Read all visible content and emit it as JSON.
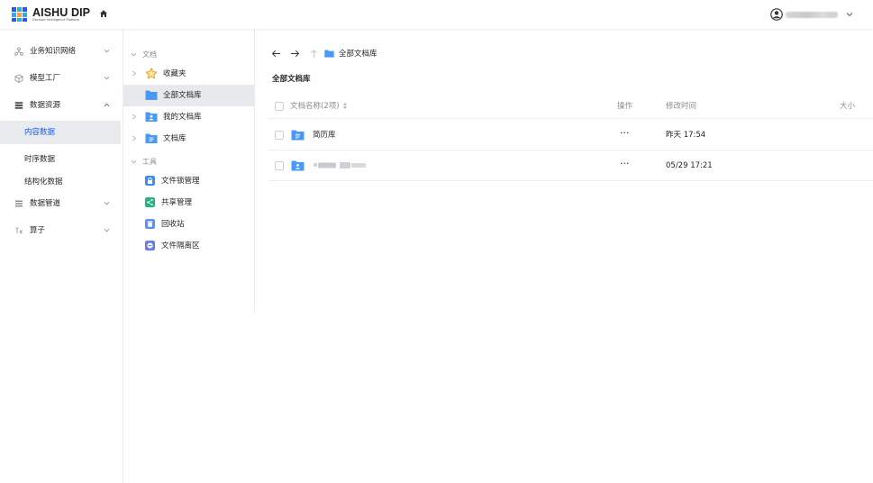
{
  "header": {
    "logo_title": "AISHU DIP",
    "logo_subtitle": "Decision Intelligence Platform",
    "icons": {
      "home": "home-icon",
      "user": "user-icon",
      "caret": "chevron-down-icon"
    }
  },
  "left_nav": {
    "items": [
      {
        "label": "业务知识网络",
        "icon": "network-icon",
        "expanded": false
      },
      {
        "label": "模型工厂",
        "icon": "cube-icon",
        "expanded": false
      },
      {
        "label": "数据资源",
        "icon": "database-icon",
        "expanded": true
      },
      {
        "label": "数据管道",
        "icon": "pipeline-icon",
        "expanded": false
      },
      {
        "label": "算子",
        "icon": "operator-icon",
        "expanded": false
      }
    ],
    "sub_items": [
      {
        "label": "内容数据",
        "active": true
      },
      {
        "label": "时序数据",
        "active": false
      },
      {
        "label": "结构化数据",
        "active": false
      }
    ]
  },
  "tree": {
    "docs_section": "文档",
    "docs": [
      {
        "label": "收藏夹",
        "icon": "star-icon",
        "selected": false
      },
      {
        "label": "全部文档库",
        "icon": "folder-icon",
        "selected": true
      },
      {
        "label": "我的文档库",
        "icon": "user-folder-icon",
        "selected": false
      },
      {
        "label": "文档库",
        "icon": "doc-folder-icon",
        "selected": false
      }
    ],
    "tools_section": "工具",
    "tools": [
      {
        "label": "文件锁管理",
        "icon": "lock-icon",
        "color": "#3b8ef0"
      },
      {
        "label": "共享管理",
        "icon": "share-icon",
        "color": "#20b37a"
      },
      {
        "label": "回收站",
        "icon": "trash-icon",
        "color": "#5b8ff9"
      },
      {
        "label": "文件隔离区",
        "icon": "isolation-icon",
        "color": "#6a7cf5"
      }
    ]
  },
  "main": {
    "path_label": "全部文档库",
    "page_title": "全部文档库",
    "table": {
      "columns": {
        "name": "文档名称(2项)",
        "action": "操作",
        "modified": "修改时间",
        "size": "大小"
      },
      "rows": [
        {
          "name": "简历库",
          "icon": "doc-folder-icon",
          "action": "···",
          "modified": "昨天 17:54"
        },
        {
          "name": "",
          "icon": "user-folder-icon",
          "action": "···",
          "modified": "05/29 17:21"
        }
      ]
    }
  },
  "colors": {
    "accent": "#1a5cf0",
    "folder_blue": "#4a9af5",
    "star_orange": "#f5a623",
    "selected_bg": "#e8e9ed"
  }
}
